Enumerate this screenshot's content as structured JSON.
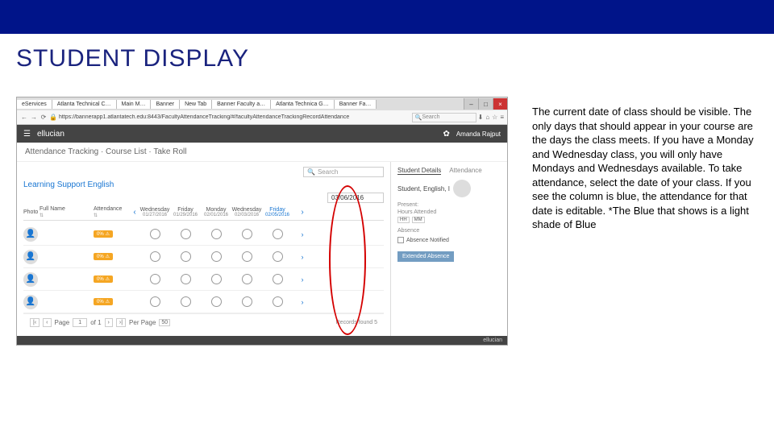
{
  "slide": {
    "title": "STUDENT DISPLAY",
    "explanation": "The current date of class should be visible. The only days that should appear in your course are the days the class meets. If you have a Monday and Wednesday class, you will only have Mondays and Wednesdays available. To take attendance, select the date of your class. If you see the column is blue, the attendance for that date is editable. *The Blue that shows is a light shade of Blue"
  },
  "browser": {
    "tabs": [
      "eServices",
      "Atlanta Technical C…",
      "Main M…",
      "Banner",
      "New Tab",
      "Banner Faculty a…",
      "Atlanta Technica G…",
      "Banner Fa…"
    ],
    "url": "https://bannerapp1.atlantatech.edu:8443/FacultyAttendanceTracking/#/facultyAttendanceTrackingRecordAttendance",
    "search_placeholder": "Search"
  },
  "app": {
    "brand": "ellucian",
    "user": "Amanda Rajput",
    "breadcrumb": "Attendance Tracking · Course List · Take Roll",
    "course": "Learning Support English",
    "date": "03/06/2016",
    "footer": "ellucian"
  },
  "grid": {
    "cols": {
      "photo": "Photo",
      "name": "Full Name",
      "attend": "Attendance"
    },
    "days": [
      {
        "day": "Wednesday",
        "date": "01/27/2016"
      },
      {
        "day": "Friday",
        "date": "01/29/2016"
      },
      {
        "day": "Monday",
        "date": "02/01/2016"
      },
      {
        "day": "Wednesday",
        "date": "02/03/2016"
      },
      {
        "day": "Friday",
        "date": "02/05/2016",
        "current": true
      }
    ],
    "rows": [
      {
        "name": " ",
        "warn": "0%"
      },
      {
        "name": " ",
        "warn": "0%"
      },
      {
        "name": " ",
        "warn": "0%"
      },
      {
        "name": " ",
        "warn": "0%"
      }
    ],
    "chevron_left": "‹",
    "chevron_right": "›"
  },
  "pager": {
    "first": "|‹",
    "prev": "‹",
    "page_label": "Page",
    "page": "1",
    "of": "of 1",
    "next": "›",
    "last": "›|",
    "per_page_label": "Per Page",
    "per_page": "50",
    "records": "Records found 5"
  },
  "details": {
    "tab_details": "Student Details",
    "tab_attendance": "Attendance",
    "student_name": "Student, English, I",
    "present_label": "Present:",
    "hours_label": "Hours Attended",
    "hh": "HH",
    "mm": "MM",
    "absence_label": "Absence",
    "notified_label": "Absence Notified",
    "ext_btn": "Extended Absence"
  },
  "search": {
    "placeholder": "Search"
  }
}
